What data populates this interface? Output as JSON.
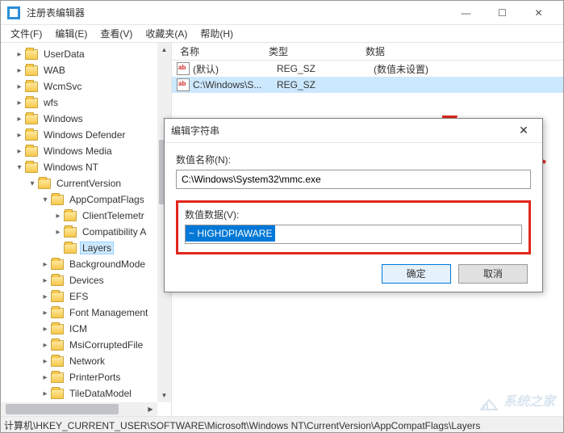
{
  "window": {
    "title": "注册表编辑器"
  },
  "menu": {
    "file": "文件(F)",
    "edit": "编辑(E)",
    "view": "查看(V)",
    "favorites": "收藏夹(A)",
    "help": "帮助(H)"
  },
  "tree": [
    {
      "depth": 1,
      "twisty": ">",
      "label": "UserData"
    },
    {
      "depth": 1,
      "twisty": ">",
      "label": "WAB"
    },
    {
      "depth": 1,
      "twisty": ">",
      "label": "WcmSvc"
    },
    {
      "depth": 1,
      "twisty": ">",
      "label": "wfs"
    },
    {
      "depth": 1,
      "twisty": ">",
      "label": "Windows"
    },
    {
      "depth": 1,
      "twisty": ">",
      "label": "Windows Defender"
    },
    {
      "depth": 1,
      "twisty": ">",
      "label": "Windows Media"
    },
    {
      "depth": 1,
      "twisty": "v",
      "label": "Windows NT"
    },
    {
      "depth": 2,
      "twisty": "v",
      "label": "CurrentVersion"
    },
    {
      "depth": 3,
      "twisty": "v",
      "label": "AppCompatFlags"
    },
    {
      "depth": 4,
      "twisty": ">",
      "label": "ClientTelemetr"
    },
    {
      "depth": 4,
      "twisty": ">",
      "label": "Compatibility A"
    },
    {
      "depth": 4,
      "twisty": "",
      "label": "Layers",
      "selected": true
    },
    {
      "depth": 3,
      "twisty": ">",
      "label": "BackgroundMode"
    },
    {
      "depth": 3,
      "twisty": ">",
      "label": "Devices"
    },
    {
      "depth": 3,
      "twisty": ">",
      "label": "EFS"
    },
    {
      "depth": 3,
      "twisty": ">",
      "label": "Font Management"
    },
    {
      "depth": 3,
      "twisty": ">",
      "label": "ICM"
    },
    {
      "depth": 3,
      "twisty": ">",
      "label": "MsiCorruptedFile"
    },
    {
      "depth": 3,
      "twisty": ">",
      "label": "Network"
    },
    {
      "depth": 3,
      "twisty": ">",
      "label": "PrinterPorts"
    },
    {
      "depth": 3,
      "twisty": ">",
      "label": "TileDataModel"
    }
  ],
  "list": {
    "columns": {
      "name": "名称",
      "type": "类型",
      "data": "数据"
    },
    "rows": [
      {
        "name": "(默认)",
        "type": "REG_SZ",
        "data": "(数值未设置)",
        "selected": false
      },
      {
        "name": "C:\\Windows\\S...",
        "type": "REG_SZ",
        "data": "",
        "selected": true
      }
    ]
  },
  "dialog": {
    "title": "编辑字符串",
    "name_label": "数值名称(N):",
    "name_value": "C:\\Windows\\System32\\mmc.exe",
    "data_label": "数值数据(V):",
    "data_value": "~ HIGHDPIAWARE",
    "ok": "确定",
    "cancel": "取消"
  },
  "statusbar": "计算机\\HKEY_CURRENT_USER\\SOFTWARE\\Microsoft\\Windows NT\\CurrentVersion\\AppCompatFlags\\Layers",
  "watermark": "系统之家"
}
